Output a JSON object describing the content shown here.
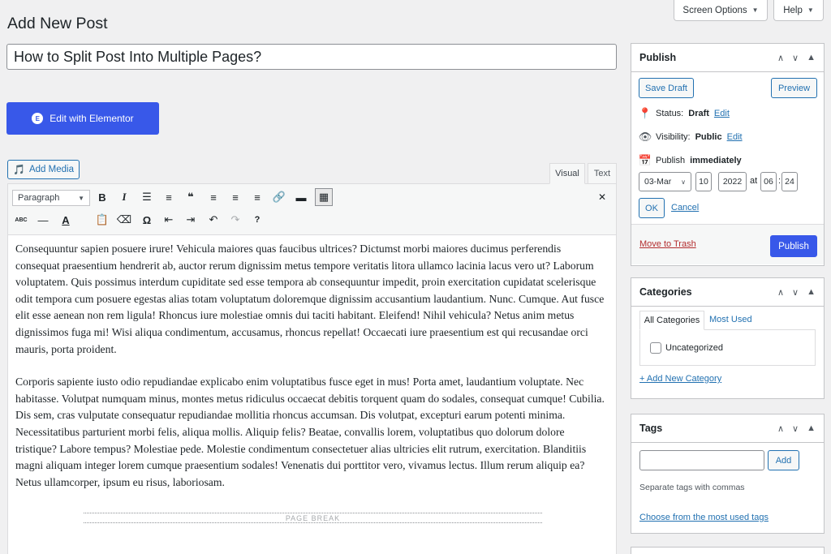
{
  "screen_meta": {
    "screen_options": "Screen Options",
    "help": "Help"
  },
  "page_title": "Add New Post",
  "post_title": "How to Split Post Into Multiple Pages?",
  "elementor_button": "Edit with Elementor",
  "add_media": "Add Media",
  "tabs": {
    "visual": "Visual",
    "text": "Text"
  },
  "toolbar": {
    "format_select": "Paragraph",
    "row1": [
      {
        "name": "bold-icon",
        "glyph": "B"
      },
      {
        "name": "italic-icon",
        "glyph": "I"
      },
      {
        "name": "bullet-list-icon",
        "glyph": "☰"
      },
      {
        "name": "numbered-list-icon",
        "glyph": "≡"
      },
      {
        "name": "blockquote-icon",
        "glyph": "❝"
      },
      {
        "name": "align-left-icon",
        "glyph": "≡"
      },
      {
        "name": "align-center-icon",
        "glyph": "≡"
      },
      {
        "name": "align-right-icon",
        "glyph": "≡"
      },
      {
        "name": "link-icon",
        "glyph": "🔗"
      },
      {
        "name": "read-more-icon",
        "glyph": "▬"
      },
      {
        "name": "toolbar-toggle-icon",
        "glyph": "▦"
      }
    ],
    "row2": [
      {
        "name": "strikethrough-icon",
        "glyph": "ABC"
      },
      {
        "name": "horizontal-line-icon",
        "glyph": "—"
      },
      {
        "name": "text-color-icon",
        "glyph": "A"
      },
      {
        "name": "paste-text-icon",
        "glyph": "📋"
      },
      {
        "name": "clear-formatting-icon",
        "glyph": "⌫"
      },
      {
        "name": "special-character-icon",
        "glyph": "Ω"
      },
      {
        "name": "outdent-icon",
        "glyph": "⇤"
      },
      {
        "name": "indent-icon",
        "glyph": "⇥"
      },
      {
        "name": "undo-icon",
        "glyph": "↶"
      },
      {
        "name": "redo-icon",
        "glyph": "↷"
      },
      {
        "name": "help-icon",
        "glyph": "?"
      }
    ],
    "fullscreen_icon": "✕"
  },
  "content": {
    "paragraph1": "Consequuntur sapien posuere irure! Vehicula maiores quas faucibus ultrices? Dictumst morbi maiores ducimus perferendis consequat praesentium hendrerit ab, auctor rerum dignissim metus tempore veritatis litora ullamco lacinia lacus vero ut? Laborum voluptatem. Quis possimus interdum cupiditate sed esse tempora ab consequuntur impedit, proin exercitation cupidatat scelerisque odit tempora cum posuere egestas alias totam voluptatum doloremque dignissim accusantium laudantium. Nunc. Cumque. Aut fusce elit esse aenean non rem ligula! Rhoncus iure molestiae omnis dui taciti habitant. Eleifend! Nihil vehicula? Netus anim metus dignissimos fuga mi! Wisi aliqua condimentum, accusamus, rhoncus repellat! Occaecati iure praesentium est qui recusandae orci mauris, porta proident.",
    "paragraph2": "Corporis sapiente iusto odio repudiandae explicabo enim voluptatibus fusce eget in mus! Porta amet, laudantium voluptate. Nec habitasse. Volutpat numquam minus, montes metus ridiculus occaecat debitis torquent quam do sodales, consequat cumque! Cubilia. Dis sem, cras vulputate consequatur repudiandae mollitia rhoncus accumsan. Dis volutpat, excepturi earum potenti minima. Necessitatibus parturient morbi felis, aliqua mollis. Aliquip felis? Beatae, convallis lorem, voluptatibus quo dolorum dolore tristique? Labore tempus? Molestiae pede. Molestie condimentum consectetuer alias ultricies elit rutrum, exercitation. Blanditiis magni aliquam integer lorem cumque praesentium sodales! Venenatis dui porttitor vero, vivamus lectus. Illum rerum aliquip ea? Netus ullamcorper, ipsum eu risus, laboriosam.",
    "page_break": "PAGE BREAK"
  },
  "publish": {
    "title": "Publish",
    "save_draft": "Save Draft",
    "preview": "Preview",
    "status_label": "Status:",
    "status_value": "Draft",
    "visibility_label": "Visibility:",
    "visibility_value": "Public",
    "edit": "Edit",
    "publish_label": "Publish",
    "publish_value": "immediately",
    "month": "03-Mar",
    "day": "10",
    "year": "2022",
    "at": "at",
    "hour": "06",
    "minute": "24",
    "ok": "OK",
    "cancel": "Cancel",
    "move_to_trash": "Move to Trash",
    "publish_button": "Publish"
  },
  "categories": {
    "title": "Categories",
    "tab_all": "All Categories",
    "tab_most_used": "Most Used",
    "items": [
      "Uncategorized"
    ],
    "add_new": "+ Add New Category"
  },
  "tags": {
    "title": "Tags",
    "add": "Add",
    "hint": "Separate tags with commas",
    "choose": "Choose from the most used tags"
  },
  "colors": {
    "primary": "#2271b1",
    "elementor": "#3858e9",
    "publish_button": "#3858e9",
    "trash": "#b32d2e"
  }
}
